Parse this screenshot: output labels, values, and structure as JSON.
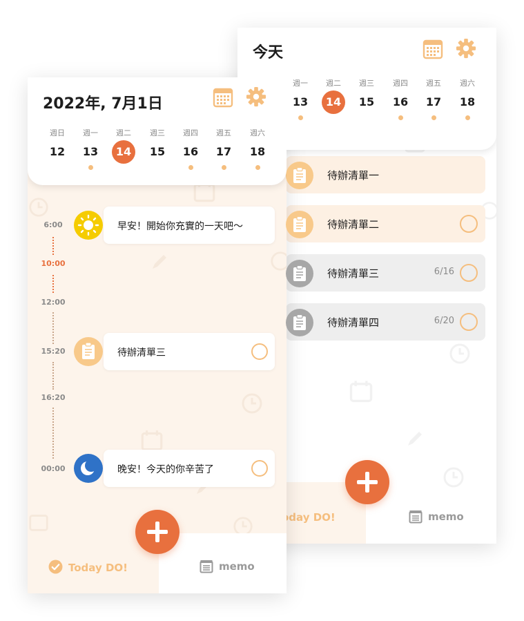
{
  "colors": {
    "accent": "#e8703e",
    "soft_orange": "#f5be7e",
    "cream": "#fdf4eb",
    "gray": "#a7a7a7"
  },
  "back_screen": {
    "title": "今天",
    "week": [
      {
        "name": "週一",
        "num": "13",
        "dot": true,
        "active": false
      },
      {
        "name": "週二",
        "num": "14",
        "dot": false,
        "active": true
      },
      {
        "name": "週三",
        "num": "15",
        "dot": false,
        "active": false
      },
      {
        "name": "週四",
        "num": "16",
        "dot": true,
        "active": false
      },
      {
        "name": "週五",
        "num": "17",
        "dot": true,
        "active": false
      },
      {
        "name": "週六",
        "num": "18",
        "dot": true,
        "active": false
      }
    ],
    "todos": [
      {
        "label": "待辦清單一",
        "count": "",
        "style": "orange",
        "checkbox": false
      },
      {
        "label": "待辦清單二",
        "count": "",
        "style": "orange",
        "checkbox": true
      },
      {
        "label": "待辦清單三",
        "count": "6/16",
        "style": "gray",
        "checkbox": true
      },
      {
        "label": "待辦清單四",
        "count": "6/20",
        "style": "gray",
        "checkbox": true
      }
    ],
    "tab_today_label": "oday DO!",
    "tab_memo_label": "memo"
  },
  "front_screen": {
    "title": "2022年, 7月1日",
    "week": [
      {
        "name": "週日",
        "num": "12",
        "dot": false,
        "active": false
      },
      {
        "name": "週一",
        "num": "13",
        "dot": true,
        "active": false
      },
      {
        "name": "週二",
        "num": "14",
        "dot": false,
        "active": true
      },
      {
        "name": "週三",
        "num": "15",
        "dot": false,
        "active": false
      },
      {
        "name": "週四",
        "num": "16",
        "dot": true,
        "active": false
      },
      {
        "name": "週五",
        "num": "17",
        "dot": true,
        "active": false
      },
      {
        "name": "週六",
        "num": "18",
        "dot": true,
        "active": false
      }
    ],
    "timeline": {
      "t1": "6:00",
      "t2": "10:00",
      "t3": "12:00",
      "t4": "15:20",
      "t5": "16:20",
      "t6": "00:00"
    },
    "events": {
      "morning": {
        "label": "早安！開始你充實的一天吧～",
        "icon": "sun-icon"
      },
      "todo": {
        "label": "待辦清單三",
        "icon": "clipboard-icon"
      },
      "night": {
        "label": "晚安！今天的你辛苦了",
        "icon": "moon-icon"
      }
    },
    "tab_today_label": "Today DO!",
    "tab_memo_label": "memo"
  }
}
